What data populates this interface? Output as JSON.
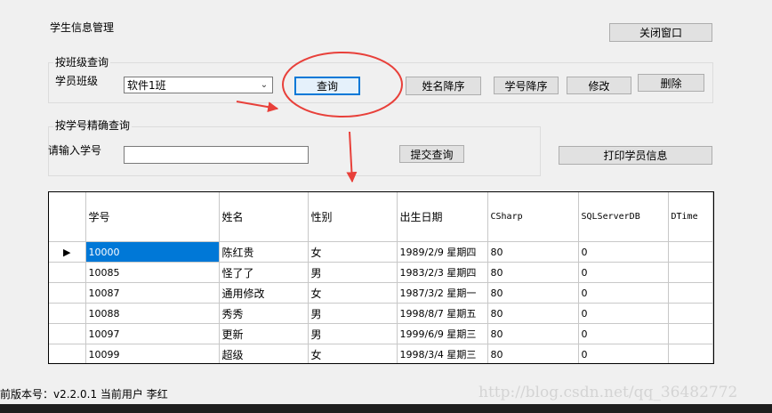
{
  "window": {
    "title": "学生信息管理",
    "close_label": "关闭窗口"
  },
  "class_query": {
    "group_title": "按班级查询",
    "class_label": "学员班级",
    "class_selected": "软件1班",
    "query_label": "查询",
    "name_desc_label": "姓名降序",
    "id_desc_label": "学号降序",
    "modify_label": "修改",
    "delete_label": "删除"
  },
  "id_query": {
    "group_title": "按学号精确查询",
    "id_label": "请输入学号",
    "id_value": "",
    "submit_label": "提交查询",
    "print_label": "打印学员信息"
  },
  "grid": {
    "columns": [
      "学号",
      "姓名",
      "性别",
      "出生日期",
      "CSharp",
      "SQLServerDB",
      "DTime"
    ],
    "rows": [
      [
        "10000",
        "陈红贵",
        "女",
        "1989/2/9 星期四",
        "80",
        "0",
        ""
      ],
      [
        "10085",
        "怪了了",
        "男",
        "1983/2/3 星期四",
        "80",
        "0",
        ""
      ],
      [
        "10087",
        "通用修改",
        "女",
        "1987/3/2 星期一",
        "80",
        "0",
        ""
      ],
      [
        "10088",
        "秀秀",
        "男",
        "1998/8/7 星期五",
        "80",
        "0",
        ""
      ],
      [
        "10097",
        "更新",
        "男",
        "1999/6/9 星期三",
        "80",
        "0",
        ""
      ],
      [
        "10099",
        "超级",
        "女",
        "1998/3/4 星期三",
        "80",
        "0",
        ""
      ]
    ]
  },
  "status": {
    "text": "前版本号：v2.2.0.1  当前用户  李红"
  },
  "watermark": "http://blog.csdn.net/qq_36482772",
  "colors": {
    "annotation": "#e8403a",
    "selection": "#0078d7"
  }
}
